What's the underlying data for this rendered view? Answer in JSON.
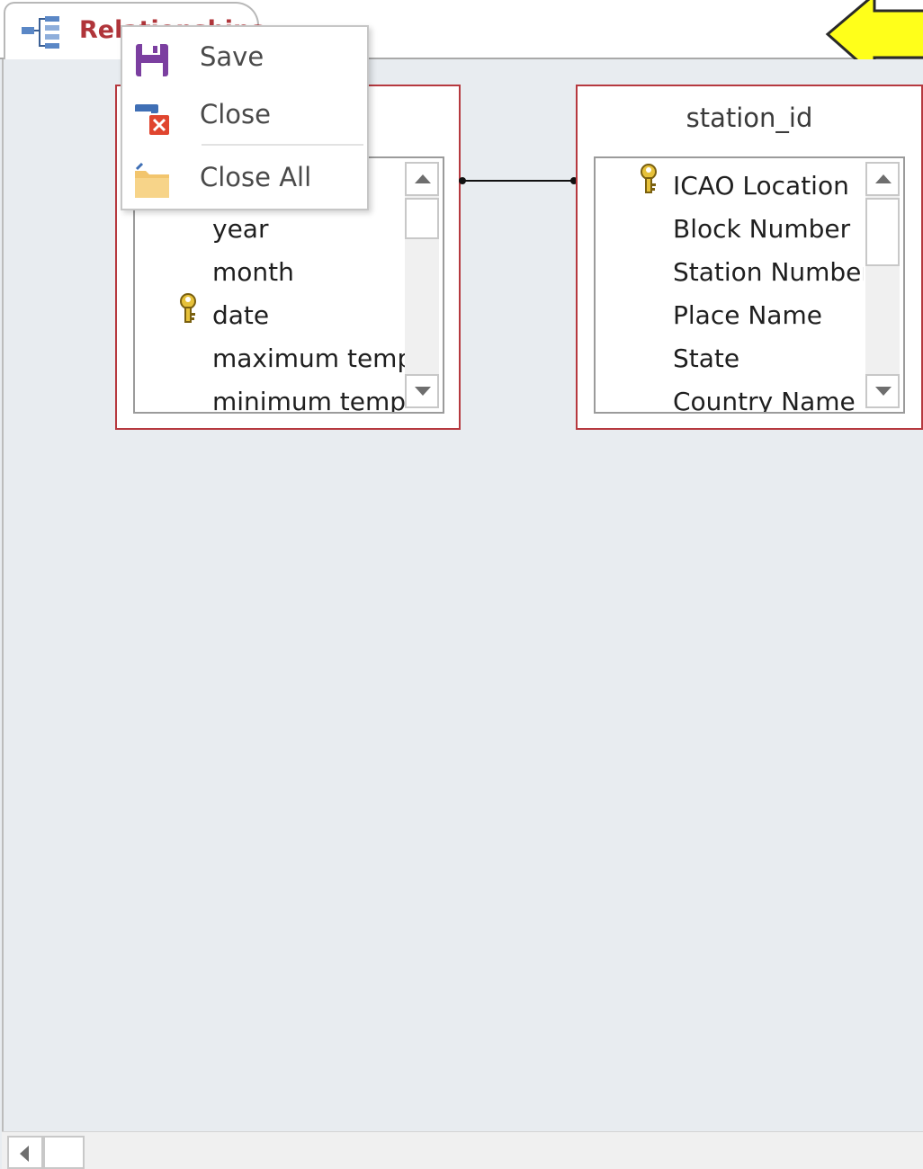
{
  "tab": {
    "label": "Relationships"
  },
  "context_menu": {
    "items": [
      {
        "label": "Save",
        "icon": "save-icon"
      },
      {
        "label": "Close",
        "icon": "close-document-icon"
      },
      {
        "label": "Close All",
        "icon": "folder-icon"
      }
    ]
  },
  "tables": {
    "left": {
      "title_visible": "T",
      "fields": [
        {
          "name": "year",
          "key": false
        },
        {
          "name": "month",
          "key": false
        },
        {
          "name": "date",
          "key": true
        },
        {
          "name": "maximum temp",
          "key": false
        },
        {
          "name": "minimum temp",
          "key": false
        }
      ]
    },
    "right": {
      "title": "station_id",
      "fields": [
        {
          "name": "ICAO Location",
          "key": true
        },
        {
          "name": "Block Number",
          "key": false
        },
        {
          "name": "Station Number",
          "key": false
        },
        {
          "name": "Place Name",
          "key": false
        },
        {
          "name": "State",
          "key": false
        },
        {
          "name": "Country Name",
          "key": false
        }
      ]
    }
  },
  "colors": {
    "table_border": "#b6393f",
    "tab_text": "#b0353a",
    "arrow_fill": "#ffff1a",
    "save_icon": "#7b3fa0",
    "close_icon": "#e0452f",
    "folder_icon": "#f2c56d"
  }
}
